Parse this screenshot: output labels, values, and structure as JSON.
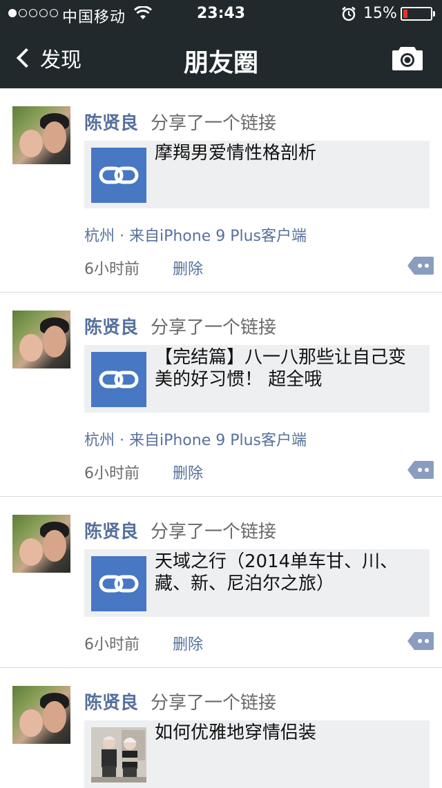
{
  "status_bar": {
    "carrier": "中国移动",
    "time": "23:43",
    "battery_percent_text": "15%",
    "battery_level": 0.15,
    "signal_bars_filled": 1,
    "signal_bars_total": 5
  },
  "nav": {
    "back_label": "发现",
    "title": "朋友圈"
  },
  "posts": [
    {
      "name": "陈贤良",
      "action": "分享了一个链接",
      "link_title": "摩羯男爱情性格剖析",
      "thumb": "link-icon",
      "location": "杭州 · 来自iPhone 9 Plus客户端",
      "time": "6小时前",
      "delete": "删除"
    },
    {
      "name": "陈贤良",
      "action": "分享了一个链接",
      "link_title": "【完结篇】八一八那些让自己变美的好习惯！ 超全哦",
      "thumb": "link-icon",
      "location": "杭州 · 来自iPhone 9 Plus客户端",
      "time": "6小时前",
      "delete": "删除"
    },
    {
      "name": "陈贤良",
      "action": "分享了一个链接",
      "link_title": "天域之行（2014单车甘、川、藏、新、尼泊尔之旅）",
      "thumb": "link-icon",
      "location": "",
      "time": "6小时前",
      "delete": "删除"
    },
    {
      "name": "陈贤良",
      "action": "分享了一个链接",
      "link_title": "如何优雅地穿情侣装",
      "thumb": "photo",
      "location": "",
      "time": "",
      "delete": ""
    }
  ],
  "colors": {
    "header_bg": "#21292c",
    "name_link": "#56709c",
    "link_thumb": "#4877c3",
    "card_bg": "#eeeff1",
    "battery_low": "#e8312b"
  }
}
